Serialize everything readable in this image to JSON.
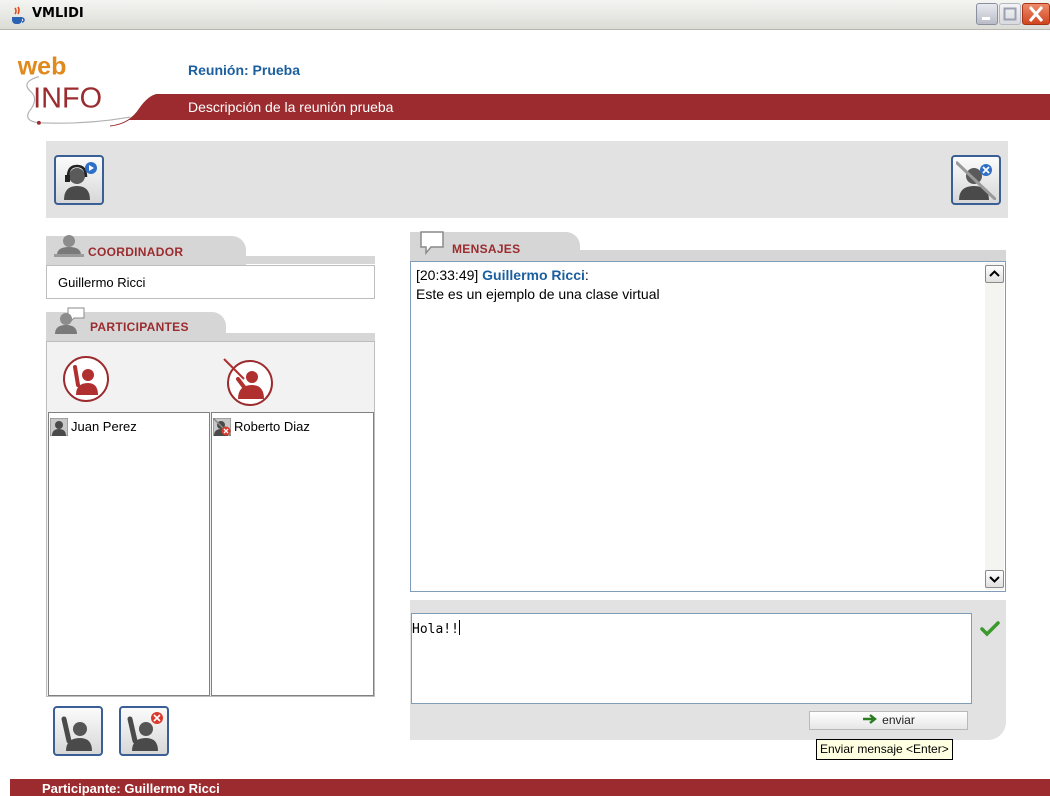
{
  "window": {
    "title": "VMLIDI"
  },
  "header": {
    "logo_top": "web",
    "logo_bottom": "INFO",
    "meeting_label": "Reunión:  Prueba",
    "meeting_description": "Descripción de la reunión prueba"
  },
  "coordinator": {
    "title": "COORDINADOR",
    "name": "Guillermo Ricci"
  },
  "participants": {
    "title": "PARTICIPANTES",
    "column1": [
      {
        "name": "Juan Perez",
        "status_icon": "user-icon"
      }
    ],
    "column2": [
      {
        "name": "Roberto Diaz",
        "status_icon": "user-removed-icon"
      }
    ]
  },
  "messages": {
    "title": "MENSAJES",
    "entries": [
      {
        "time": "[20:33:49]",
        "author": "Guillermo Ricci",
        "sep": ":",
        "text": "Este es un ejemplo de una clase virtual"
      }
    ]
  },
  "composer": {
    "value": "Hola!!",
    "send_label": "enviar",
    "tooltip": "Enviar mensaje <Enter>"
  },
  "status": {
    "text": "Participante:  Guillermo Ricci"
  },
  "colors": {
    "brand_red": "#9b2b2e",
    "link_blue": "#1b5f9e",
    "panel_gray": "#e2e2e2"
  }
}
